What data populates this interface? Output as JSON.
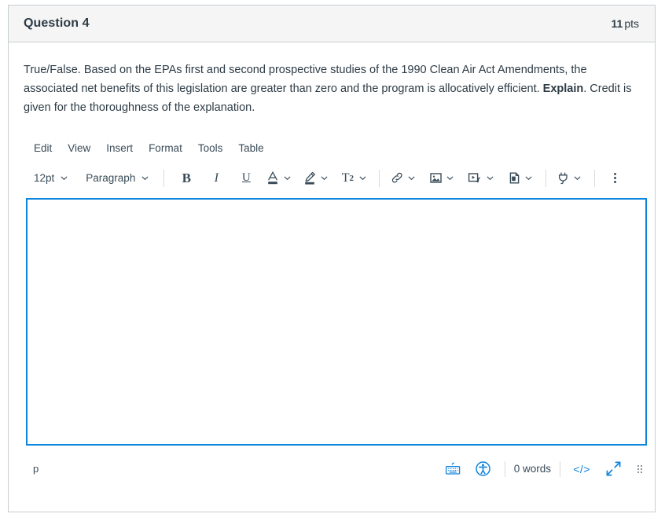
{
  "question": {
    "title": "Question 4",
    "points_value": "11",
    "points_unit": "pts",
    "text_part1": "True/False. Based on the EPAs first and second prospective studies of the 1990 Clean Air Act Amendments, the associated net benefits of this legislation are greater than zero and the program is allocatively efficient. ",
    "text_bold": "Explain",
    "text_part2": ". Credit is given for the thoroughness of the explanation."
  },
  "editor": {
    "menubar": [
      {
        "label": "Edit",
        "name": "menu-edit"
      },
      {
        "label": "View",
        "name": "menu-view"
      },
      {
        "label": "Insert",
        "name": "menu-insert"
      },
      {
        "label": "Format",
        "name": "menu-format"
      },
      {
        "label": "Tools",
        "name": "menu-tools"
      },
      {
        "label": "Table",
        "name": "menu-table"
      }
    ],
    "toolbar": {
      "font_size": "12pt",
      "block_format": "Paragraph",
      "bold_label": "B",
      "italic_label": "I",
      "underline_label": "U",
      "text_color_label": "A",
      "superscript_label": "T",
      "superscript_exponent": "2",
      "icons": [
        "chevron-down-icon",
        "text-color-icon",
        "highlight-color-icon",
        "superscript-icon",
        "link-icon",
        "image-icon",
        "media-icon",
        "document-icon",
        "apps-plug-icon",
        "more-options-kebab-icon"
      ]
    },
    "content": {
      "value": "",
      "placeholder": ""
    },
    "statusbar": {
      "element_path": "p",
      "word_count": "0 words",
      "html_editor_label": "</>",
      "icons": [
        "keyboard-shortcuts-icon",
        "accessibility-checker-icon",
        "html-editor-icon",
        "fullscreen-expand-icon",
        "resize-grip-icon"
      ]
    }
  },
  "colors": {
    "focus_border": "#0E85DC",
    "header_bg": "#F5F5F5",
    "card_border": "#C7CDD1",
    "text": "#2D3B45",
    "toolbar_icon": "#394B58",
    "accent_blue": "#0E85DC"
  }
}
